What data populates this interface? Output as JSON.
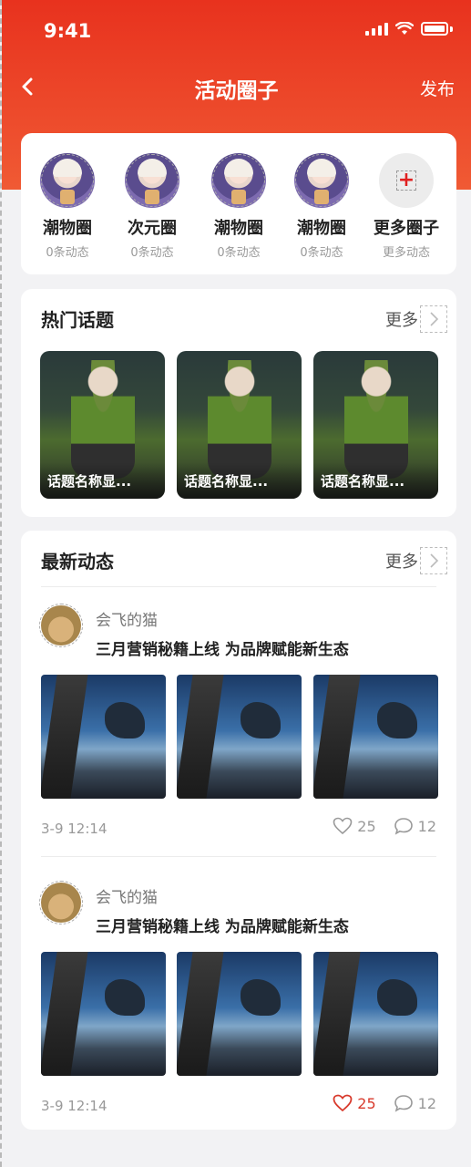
{
  "status_bar": {
    "time": "9:41"
  },
  "nav": {
    "title": "活动圈子",
    "action": "发布",
    "back_icon": "chevron-left-icon"
  },
  "circles": {
    "items": [
      {
        "name": "潮物圈",
        "count": "0条动态"
      },
      {
        "name": "次元圈",
        "count": "0条动态"
      },
      {
        "name": "潮物圈",
        "count": "0条动态"
      },
      {
        "name": "潮物圈",
        "count": "0条动态"
      }
    ],
    "more": {
      "name": "更多圈子",
      "count": "更多动态"
    }
  },
  "hot_topics": {
    "title": "热门话题",
    "more": "更多",
    "items": [
      {
        "label": "话题名称显..."
      },
      {
        "label": "话题名称显..."
      },
      {
        "label": "话题名称显..."
      }
    ]
  },
  "feed": {
    "title": "最新动态",
    "more": "更多",
    "posts": [
      {
        "user": "会飞的猫",
        "text": "三月营销秘籍上线 为品牌赋能新生态",
        "time": "3-9 12:14",
        "likes": "25",
        "comments": "12",
        "liked": false
      },
      {
        "user": "会飞的猫",
        "text": "三月营销秘籍上线 为品牌赋能新生态",
        "time": "3-9 12:14",
        "likes": "25",
        "comments": "12",
        "liked": true
      }
    ]
  },
  "colors": {
    "brand": "#e8321e",
    "liked": "#d83a2c",
    "muted": "#999999"
  }
}
